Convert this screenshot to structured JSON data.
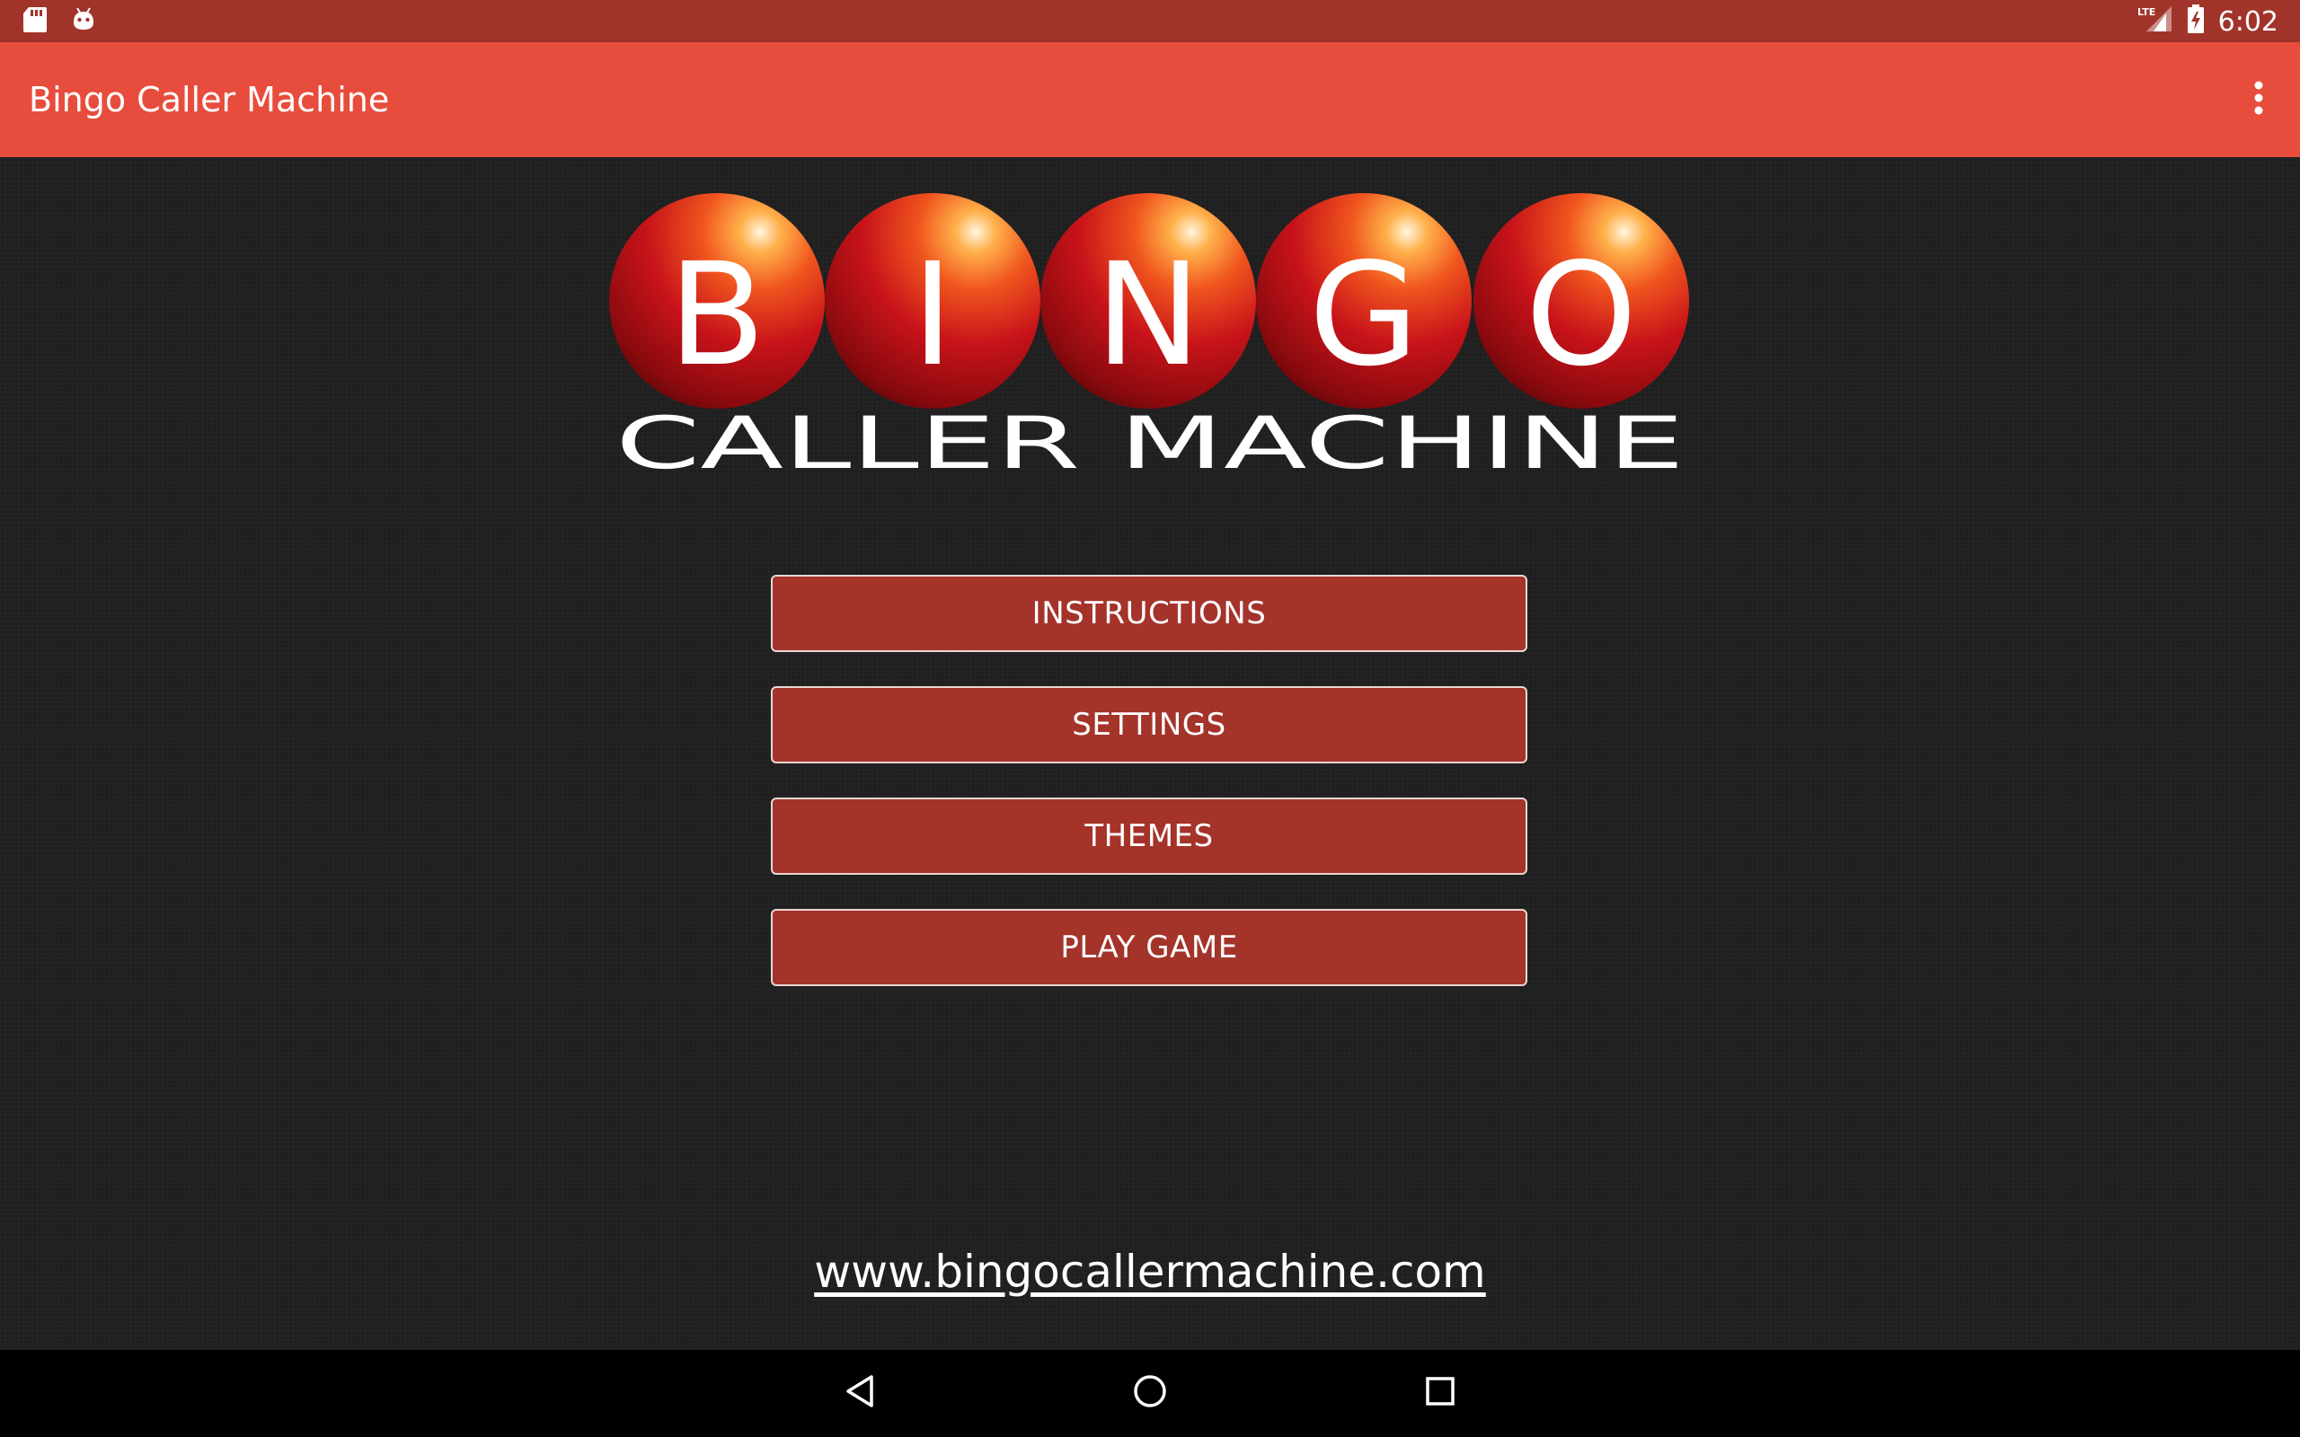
{
  "status_bar": {
    "time": "6:02",
    "left_icons": [
      "sd-card-icon",
      "android-icon"
    ],
    "right_icons": [
      "lte-signal-icon",
      "battery-charging-icon"
    ],
    "network_label": "LTE",
    "bg_color": "#a1342a"
  },
  "app_bar": {
    "title": "Bingo Caller Machine",
    "overflow_icon": "more-vert-icon",
    "bg_color": "#e84c3c"
  },
  "logo": {
    "balls": [
      "B",
      "I",
      "N",
      "G",
      "O"
    ],
    "subtitle": "CALLER MACHINE"
  },
  "menu": {
    "buttons": [
      {
        "label": "INSTRUCTIONS"
      },
      {
        "label": "SETTINGS"
      },
      {
        "label": "THEMES"
      },
      {
        "label": "PLAY GAME"
      }
    ],
    "button_color": "#a4332a"
  },
  "footer": {
    "website": "www.bingocallermachine.com"
  },
  "nav_bar": {
    "buttons": [
      "back-icon",
      "home-icon",
      "recents-icon"
    ]
  }
}
